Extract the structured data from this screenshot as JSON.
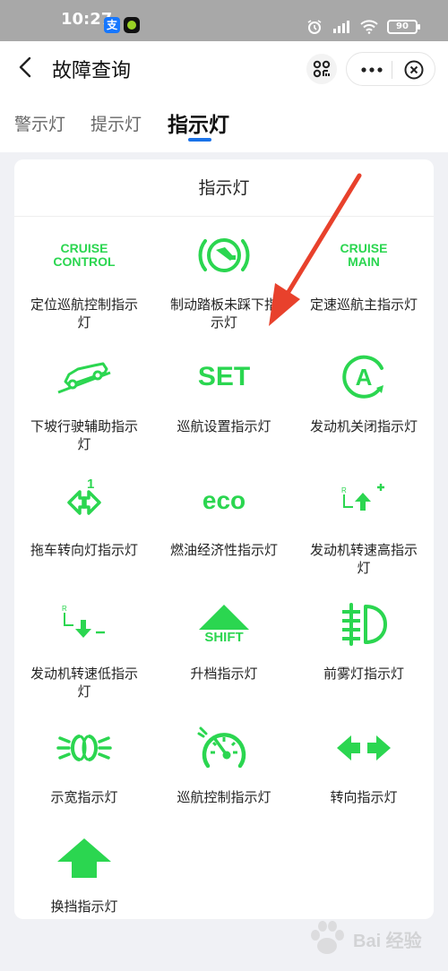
{
  "status_bar": {
    "time": "10:27",
    "app1_glyph": "支",
    "battery": "90"
  },
  "nav": {
    "title": "故障查询"
  },
  "tabs": [
    {
      "label": "警示灯"
    },
    {
      "label": "提示灯"
    },
    {
      "label": "指示灯",
      "active": true
    }
  ],
  "card": {
    "title": "指示灯",
    "items": [
      {
        "label": "定位巡航控制指示灯",
        "icon": "cruise-control-text-icon",
        "icon_text": [
          "CRUISE",
          "CONTROL"
        ]
      },
      {
        "label": "制动踏板未踩下指示灯",
        "icon": "brake-pedal-icon"
      },
      {
        "label": "定速巡航主指示灯",
        "icon": "cruise-main-text-icon",
        "icon_text": [
          "CRUISE",
          "MAIN"
        ]
      },
      {
        "label": "下坡行驶辅助指示灯",
        "icon": "hill-descent-icon"
      },
      {
        "label": "巡航设置指示灯",
        "icon": "set-text-icon",
        "icon_text": [
          "SET"
        ]
      },
      {
        "label": "发动机关闭指示灯",
        "icon": "auto-stop-icon"
      },
      {
        "label": "拖车转向灯指示灯",
        "icon": "trailer-turn-signal-icon"
      },
      {
        "label": "燃油经济性指示灯",
        "icon": "eco-text-icon",
        "icon_text": [
          "eco"
        ]
      },
      {
        "label": "发动机转速高指示灯",
        "icon": "shift-up-icon"
      },
      {
        "label": "发动机转速低指示灯",
        "icon": "shift-down-icon"
      },
      {
        "label": "升档指示灯",
        "icon": "shift-triangle-icon",
        "icon_text": [
          "SHIFT"
        ]
      },
      {
        "label": "前雾灯指示灯",
        "icon": "front-fog-light-icon"
      },
      {
        "label": "示宽指示灯",
        "icon": "side-marker-light-icon"
      },
      {
        "label": "巡航控制指示灯",
        "icon": "cruise-speedometer-icon"
      },
      {
        "label": "转向指示灯",
        "icon": "turn-signal-icon"
      },
      {
        "label": "换挡指示灯",
        "icon": "shift-arrow-up-icon"
      }
    ]
  },
  "watermark": {
    "text": "Bai 经验"
  },
  "colors": {
    "indicator_green": "#2bd650",
    "tab_accent": "#1a73e8",
    "annotation_arrow": "#e8412c"
  }
}
